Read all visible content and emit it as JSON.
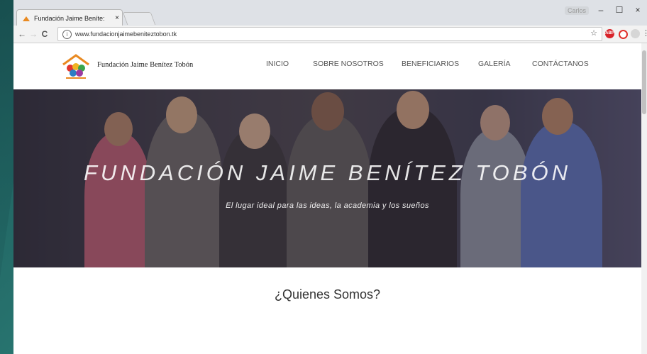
{
  "browser": {
    "tab_title": "Fundación Jaime Beníte:",
    "tab_close": "×",
    "profile_label": "Carlos",
    "minimize": "–",
    "maximize": "☐",
    "close": "×",
    "url": "www.fundacionjaimebeniteztobon.tk",
    "url_info": "i",
    "bookmark": "☆",
    "menu": "⋮",
    "back": "←",
    "forward": "→",
    "reload": "C",
    "ext_adblock": "ABP",
    "ext_opera": "O"
  },
  "site": {
    "name": "Fundación Jaime Benítez Tobón",
    "nav": [
      "INICIO",
      "SOBRE NOSOTROS",
      "BENEFICIARIOS",
      "GALERÍA",
      "CONTÁCTANOS"
    ],
    "hero_title": "FUNDACIÓN JAIME BENÍTEZ TOBÓN",
    "hero_subtitle": "El lugar ideal para las ideas, la academia y los sueños",
    "section_title": "¿Quienes Somos?"
  },
  "colors": {
    "desktop_bg": "#2a7a74",
    "logo_roof": "#e98a22",
    "hero_overlay": "#3c3b4b"
  },
  "icons": [
    "tab-favicon",
    "info-icon",
    "star-icon",
    "adblock-icon",
    "opera-icon",
    "extension-icon",
    "menu-icon"
  ]
}
